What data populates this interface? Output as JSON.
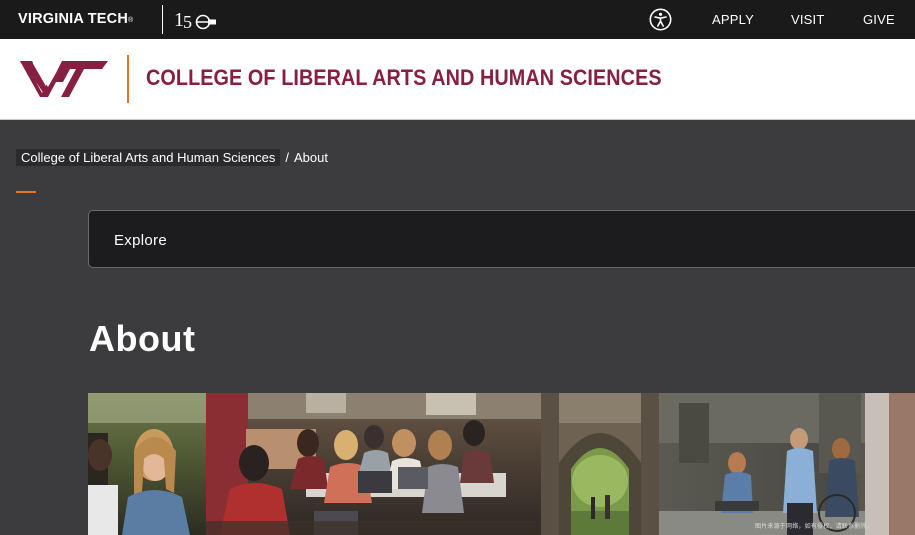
{
  "topbar": {
    "brand": "VIRGINIA TECH",
    "brand_mark": "®",
    "anniversary_icon": "150-years-mark",
    "accessibility_icon": "accessibility-icon",
    "links": [
      "APPLY",
      "VISIT",
      "GIVE"
    ]
  },
  "header": {
    "logo": "VT",
    "title": "COLLEGE OF LIBERAL ARTS AND HUMAN SCIENCES"
  },
  "breadcrumb": {
    "parent": "College of Liberal Arts and Human Sciences",
    "separator": "/",
    "current": "About"
  },
  "explore": {
    "label": "Explore"
  },
  "page": {
    "title": "About"
  },
  "banner": {
    "photos": [
      "student-smiling-photo",
      "students-studying-photo",
      "stone-archway-photo",
      "students-walking-photo"
    ],
    "watermark": "图片来源于网络，如有侵权，请联系删除。"
  },
  "colors": {
    "maroon": "#861f41",
    "orange": "#e5751f",
    "topbar_bg": "#1a1a1a",
    "page_bg": "#3c3c3e"
  }
}
